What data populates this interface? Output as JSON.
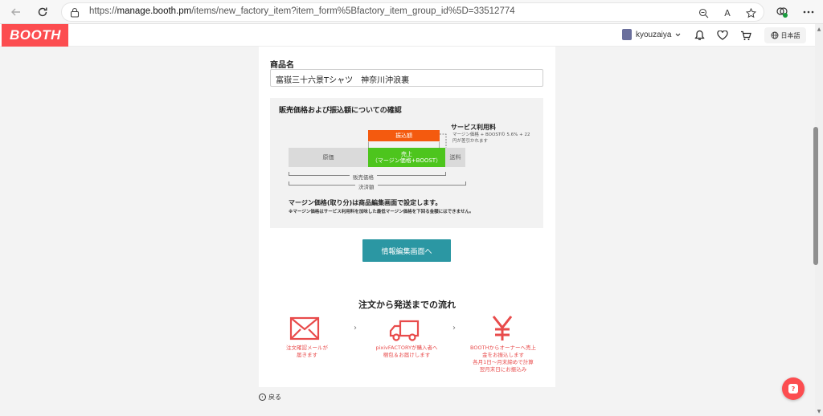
{
  "browser": {
    "url_prefix": "https://",
    "url_domain": "manage.booth.pm",
    "url_path": "/items/new_factory_item?item_form%5Bfactory_item_group_id%5D=33512774",
    "reader_icon_text": "A"
  },
  "header": {
    "logo": "BOOTH",
    "username": "kyouzaiya",
    "language": "日本語",
    "brand_color": "#fc4d50"
  },
  "form": {
    "item_name_label": "商品名",
    "item_name_value": "富嶽三十六景Tシャツ　神奈川沖浪裏"
  },
  "confirm": {
    "title": "販売価格および振込額についての確認",
    "furikomi": "振込額",
    "service_fee_title": "サービス利用料",
    "service_fee_desc": "マージン価格 + BOOSTの 5.6% + 22円が差引かれます",
    "genka": "原価",
    "uriage_line1": "売上",
    "uriage_line2": "（マージン価格+BOOST）",
    "souryou": "送料",
    "hanbai_kakaku": "販売価格",
    "kessai_gaku": "決済額",
    "note_bold": "マージン価格(取り分)は商品編集画面で設定します。",
    "note_small": "※マージン価格はサービス利用料を加味した最低マージン価格を下回る金額にはできません。",
    "colors": {
      "furikomi": "#f45a0f",
      "uriage": "#4dc51d",
      "gray": "#dadada"
    }
  },
  "edit_button": "情報編集画面へ",
  "flow": {
    "title": "注文から発送までの流れ",
    "arrow": "›",
    "steps": [
      {
        "icon": "mail-icon",
        "text": "注文確認メールが\n届きます"
      },
      {
        "icon": "truck-icon",
        "text": "pixivFACTORYが購入者へ\n梱包＆お届けします"
      },
      {
        "icon": "yen-icon",
        "text": "BOOTHからオーナーへ売上\n金をお振込します\n各月1日〜月末締めで計算\n翌月末日にお振込み"
      }
    ],
    "accent_color": "#e84b4b"
  },
  "back_link": "戻る",
  "help_icon_text": "?"
}
